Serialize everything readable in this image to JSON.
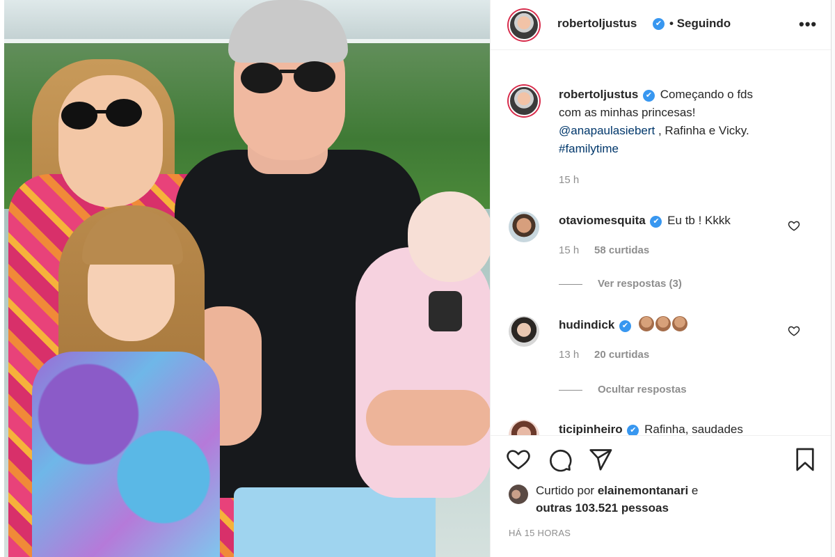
{
  "post": {
    "author": "robertoljustus",
    "follow_status": "Seguindo",
    "more_label": "•••"
  },
  "caption": {
    "username": "robertoljustus",
    "text_line1": "Começando o fds",
    "text_line2": "com as minhas princesas!",
    "mention": "@anapaulasiebert",
    "text_after_mention": " , Rafinha e Vicky.",
    "hashtag": "#familytime",
    "time": "15 h"
  },
  "comments": [
    {
      "username": "otaviomesquita",
      "text": "Eu tb ! Kkkk",
      "time": "15 h",
      "likes": "58 curtidas",
      "replies_label": "Ver respostas (3)"
    },
    {
      "username": "hudindick",
      "text": "",
      "emoji_count": 3,
      "time": "13 h",
      "likes": "20 curtidas",
      "replies_label": "Ocultar respostas"
    },
    {
      "username": "ticipinheiro",
      "text": "Rafinha, saudades"
    }
  ],
  "likes": {
    "prefix": "Curtido por ",
    "user": "elainemontanari",
    "suffix": " e",
    "others": "outras 103.521 pessoas"
  },
  "timestamp": "HÁ 15 HORAS",
  "colors": {
    "verified": "#3897f0",
    "link": "#00376b",
    "muted": "#8e8e8e",
    "story_ring": "#d72a4a"
  },
  "icons": {
    "verified": "✔",
    "like": "heart-icon",
    "comment": "comment-icon",
    "share": "paper-plane-icon",
    "save": "bookmark-icon"
  }
}
